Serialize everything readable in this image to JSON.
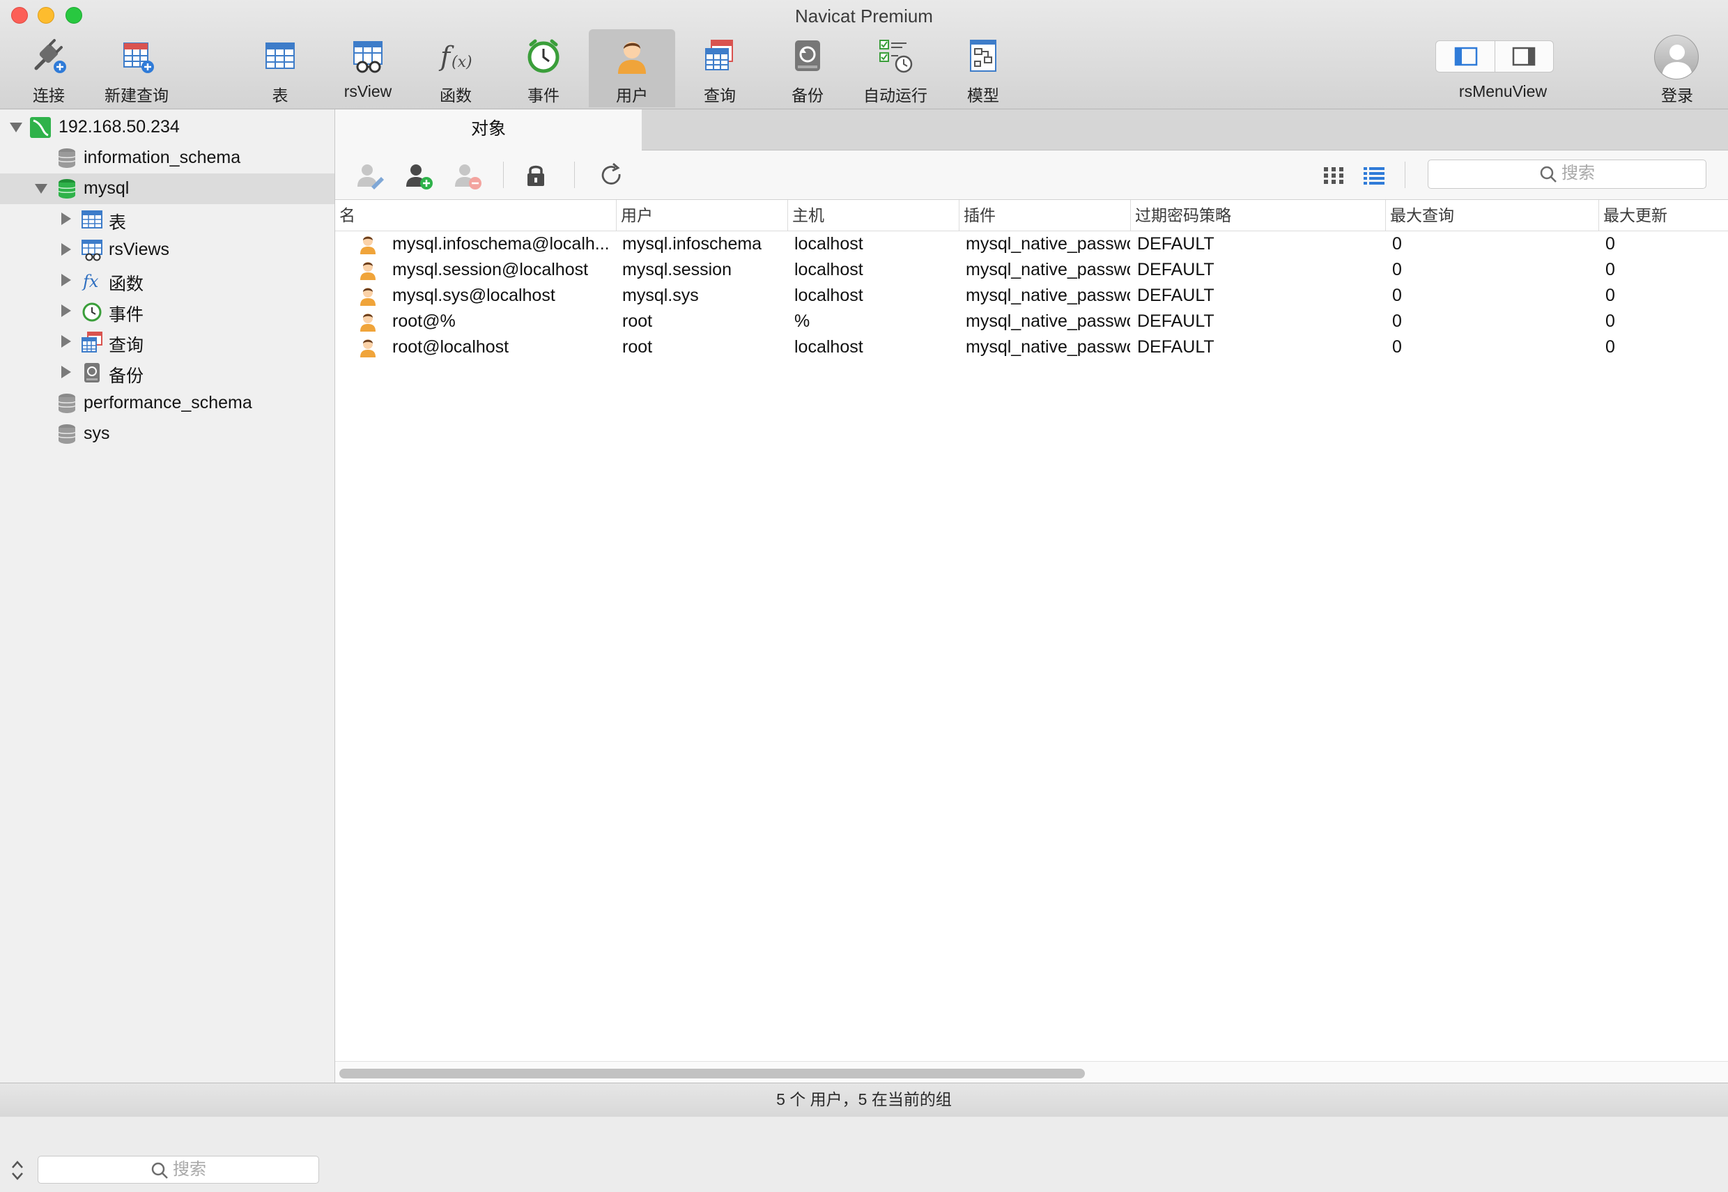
{
  "window": {
    "title": "Navicat Premium"
  },
  "toolbar": {
    "items": [
      {
        "label": "连接",
        "icon": "connection-plug-icon"
      },
      {
        "label": "新建查询",
        "icon": "new-query-icon"
      },
      {
        "label": "表",
        "icon": "table-icon"
      },
      {
        "label": "rsView",
        "icon": "view-glasses-icon"
      },
      {
        "label": "函数",
        "icon": "function-fx-icon"
      },
      {
        "label": "事件",
        "icon": "event-clock-icon"
      },
      {
        "label": "用户",
        "icon": "user-icon",
        "active": true
      },
      {
        "label": "查询",
        "icon": "query-icon"
      },
      {
        "label": "备份",
        "icon": "backup-icon"
      },
      {
        "label": "自动运行",
        "icon": "automation-icon"
      },
      {
        "label": "模型",
        "icon": "model-icon"
      }
    ],
    "layout_toggle_label": "rsMenuView",
    "login_label": "登录"
  },
  "sidebar": {
    "connection": "192.168.50.234",
    "databases": [
      {
        "name": "information_schema"
      },
      {
        "name": "mysql",
        "expanded": true,
        "selected": true
      },
      {
        "name": "performance_schema"
      },
      {
        "name": "sys"
      }
    ],
    "mysql_children": [
      {
        "label": "表",
        "icon": "table-icon"
      },
      {
        "label": "rsViews",
        "icon": "view-glasses-icon"
      },
      {
        "label": "函数",
        "icon": "function-fx-icon"
      },
      {
        "label": "事件",
        "icon": "event-clock-icon"
      },
      {
        "label": "查询",
        "icon": "query-icon"
      },
      {
        "label": "备份",
        "icon": "backup-icon"
      }
    ],
    "search_placeholder": "搜索"
  },
  "main": {
    "tab_label": "对象",
    "search_placeholder": "搜索",
    "columns": [
      "名",
      "用户",
      "主机",
      "插件",
      "过期密码策略",
      "最大查询",
      "最大更新"
    ],
    "rows": [
      [
        "mysql.infoschema@localh...",
        "mysql.infoschema",
        "localhost",
        "mysql_native_passwc",
        "DEFAULT",
        "0",
        "0"
      ],
      [
        "mysql.session@localhost",
        "mysql.session",
        "localhost",
        "mysql_native_passwc",
        "DEFAULT",
        "0",
        "0"
      ],
      [
        "mysql.sys@localhost",
        "mysql.sys",
        "localhost",
        "mysql_native_passwc",
        "DEFAULT",
        "0",
        "0"
      ],
      [
        "root@%",
        "root",
        "%",
        "mysql_native_passwc",
        "DEFAULT",
        "0",
        "0"
      ],
      [
        "root@localhost",
        "root",
        "localhost",
        "mysql_native_passwc",
        "DEFAULT",
        "0",
        "0"
      ]
    ]
  },
  "status": {
    "text": "5 个 用户，5 在当前的组"
  },
  "colors": {
    "accent": "#2f7bd8",
    "db_green": "#2fb24a",
    "user_orange": "#f0a43a"
  }
}
